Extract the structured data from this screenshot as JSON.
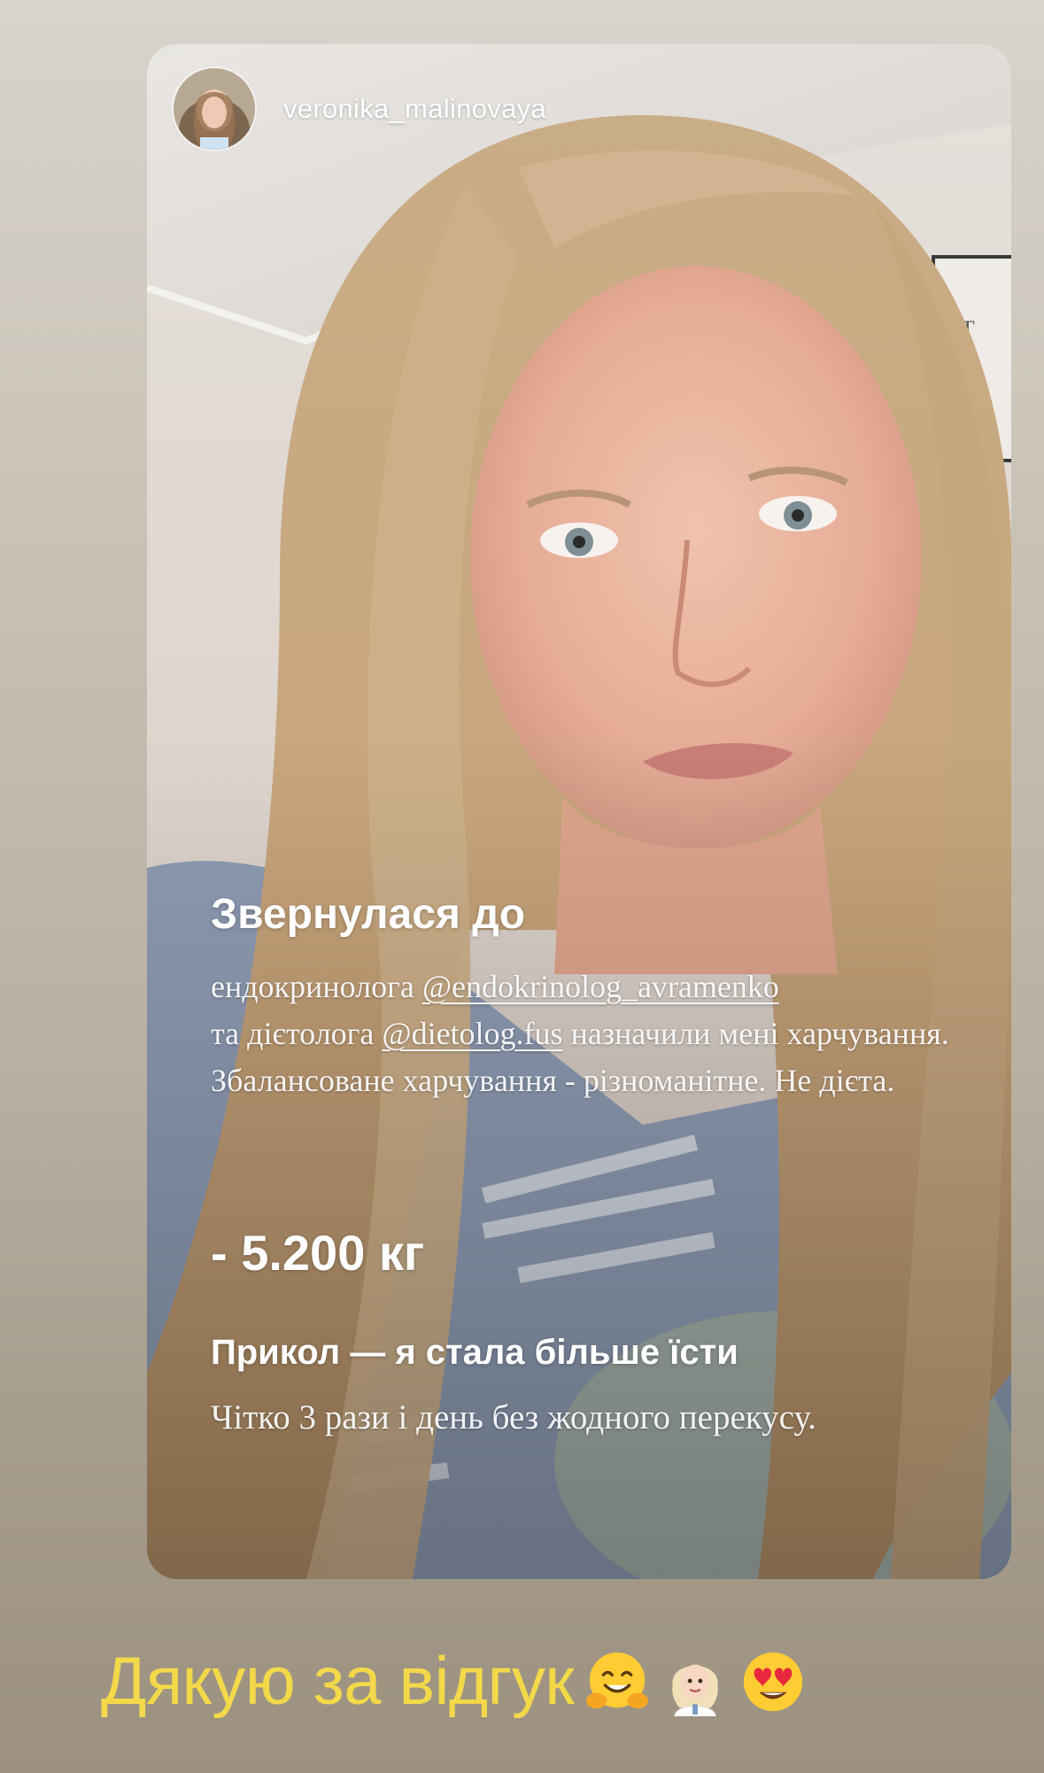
{
  "story": {
    "username": "veronika_malinovaya",
    "title": "Звернулася до",
    "body": {
      "part1": "ендокринолога ",
      "mention1": "@endokrinolog_avramenko",
      "part2": "та дієтолога ",
      "mention2": "@dietolog.fus",
      "part3": " назначили мені харчування. Збалансоване харчування - різноманітне. Не дієта."
    },
    "weight_change": "- 5.200 кг",
    "subtitle": "Прикол — я стала більше їсти",
    "note": "Чітко 3 рази і день без жодного перекусу."
  },
  "caption": {
    "text": "Дякую за відгук",
    "emojis": [
      "hugging-face-icon",
      "woman-health-worker-icon",
      "heart-eyes-face-icon"
    ]
  },
  "colors": {
    "caption_text": "#f3d94a",
    "overlay_text": "#ffffff"
  }
}
